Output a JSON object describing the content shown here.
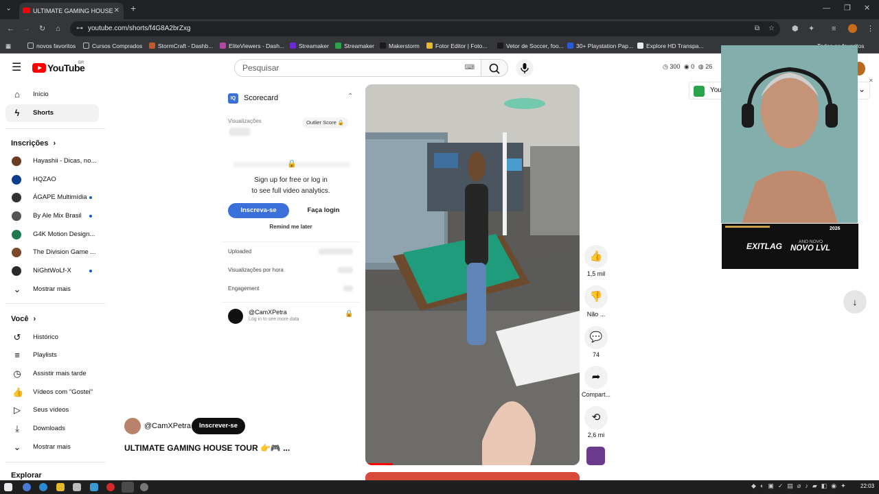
{
  "browser": {
    "tab_title": "ULTIMATE GAMING HOUSE",
    "url": "youtube.com/shorts/f4G8A2brZxg",
    "bookmarks": [
      "novos favoritos",
      "Cursos Comprados",
      "StormCraft - Dashb...",
      "EliteViewers - Dash...",
      "Streamaker",
      "Streamaker",
      "Makerstorm",
      "Fotor Editor | Foto...",
      "Vetor de Soccer, foo...",
      "30+ Playstation Pap...",
      "Explore HD Transpa..."
    ],
    "bookmarks_right": "Todos os favoritos"
  },
  "masthead": {
    "logo_text": "YouTube",
    "country": "BR",
    "search_placeholder": "Pesquisar",
    "stats": {
      "views": "300",
      "eye": "0",
      "count": "26"
    }
  },
  "sidebar": {
    "main": [
      {
        "label": "Início",
        "icon": "home-icon"
      },
      {
        "label": "Shorts",
        "icon": "shorts-icon"
      }
    ],
    "subs_title": "Inscrições",
    "subs": [
      {
        "label": "Hayashii - Dicas, no...",
        "color": "#6b3b22",
        "dot": false
      },
      {
        "label": "HQZAO",
        "color": "#0b3f8c",
        "dot": false
      },
      {
        "label": "ÁGAPE Multimídia",
        "color": "#333333",
        "dot": true
      },
      {
        "label": "By Ale Mix Brasil",
        "color": "#555555",
        "dot": true
      },
      {
        "label": "G4K Motion Design...",
        "color": "#1f7a4d",
        "dot": false
      },
      {
        "label": "The Division Game ...",
        "color": "#7a4a2a",
        "dot": false
      },
      {
        "label": "NiGhtWoLf-X",
        "color": "#2a2a2a",
        "dot": true
      }
    ],
    "subs_more": "Mostrar mais",
    "you_title": "Você",
    "you": [
      {
        "label": "Histórico",
        "icon": "history-icon"
      },
      {
        "label": "Playlists",
        "icon": "playlist-icon"
      },
      {
        "label": "Assistir mais tarde",
        "icon": "clock-icon"
      },
      {
        "label": "Vídeos com \"Gostei\"",
        "icon": "thumbs-up-icon"
      },
      {
        "label": "Seus vídeos",
        "icon": "video-icon"
      },
      {
        "label": "Downloads",
        "icon": "download-icon"
      }
    ],
    "you_more": "Mostrar mais",
    "explore_title": "Explorar"
  },
  "scorecard": {
    "title": "Scorecard",
    "views_label": "Visualizações",
    "outlier_label": "Outlier Score",
    "signup_line1": "Sign up for free or log in",
    "signup_line2": "to see full video analytics.",
    "subscribe_btn": "Inscreva-se",
    "login_btn": "Faça login",
    "remind": "Remind me later",
    "rows": [
      "Uploaded",
      "Visualizações por hora",
      "Engagement"
    ],
    "channel": "@CamXPetra",
    "channel_sub": "Log in to see more data"
  },
  "video": {
    "channel": "@CamXPetra",
    "subscribe": "Inscrever-se",
    "title": "ULTIMATE GAMING HOUSE TOUR 👉🎮 ..."
  },
  "actions": {
    "likes": "1,5 mil",
    "dislike": "Não ...",
    "comments": "74",
    "share": "Compart...",
    "remix": "2,6 mi"
  },
  "overlay": {
    "banner_brand": "EXITLAG",
    "banner_small": "ANO NOVO",
    "banner_big": "NOVO LVL",
    "banner_year": "2026"
  },
  "right_panel": {
    "label": "You"
  },
  "taskbar": {
    "time": "22:03"
  }
}
